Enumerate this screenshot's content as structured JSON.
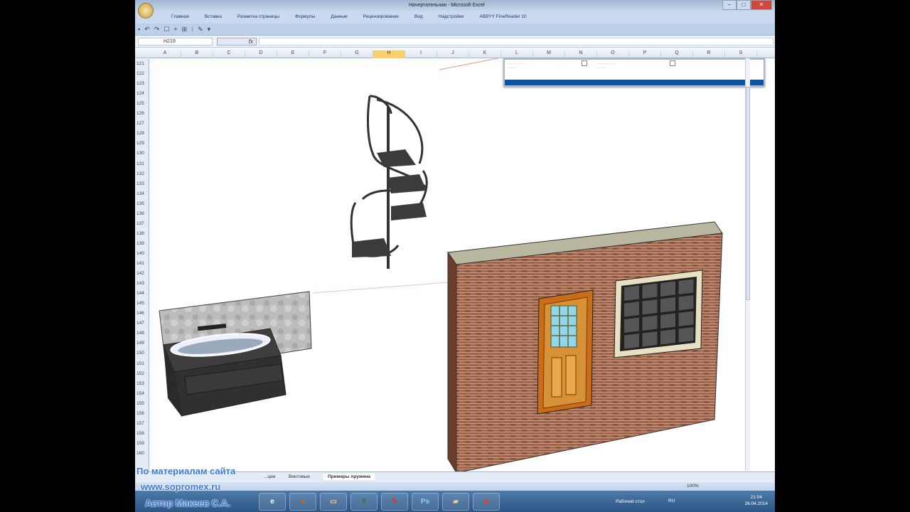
{
  "window": {
    "title": "Начертательная - Microsoft Excel"
  },
  "ribbon": {
    "tabs": [
      "Главная",
      "Вставка",
      "Разметка страницы",
      "Формулы",
      "Данные",
      "Рецензирование",
      "Вид",
      "Надстройки",
      "ABBYY FineReader 10"
    ]
  },
  "formula_bar": {
    "name_box": "H219",
    "fx": "fx",
    "value": ""
  },
  "columns": [
    "A",
    "B",
    "C",
    "D",
    "E",
    "F",
    "G",
    "H",
    "I",
    "J",
    "K",
    "L",
    "M",
    "N",
    "O",
    "P",
    "Q",
    "R",
    "S"
  ],
  "selected_column": "H",
  "rows": [
    121,
    122,
    123,
    124,
    125,
    126,
    127,
    128,
    129,
    130,
    131,
    132,
    133,
    134,
    135,
    136,
    137,
    138,
    139,
    140,
    141,
    142,
    143,
    144,
    145,
    146,
    147,
    148,
    149,
    150,
    151,
    152,
    153,
    154,
    155,
    156,
    157,
    158,
    159,
    160
  ],
  "sheet_tabs": [
    {
      "label": "...ции",
      "active": false
    },
    {
      "label": "Винтовые",
      "active": false
    },
    {
      "label": "Примеры пружина",
      "active": true
    }
  ],
  "status": {
    "zoom": "100%"
  },
  "taskbar": {
    "apps": [
      "ie",
      "firefox",
      "explorer",
      "excel",
      "pen-tool",
      "photoshop",
      "folder",
      "sketchup"
    ],
    "desktop_label": "Рабочий стол",
    "lang": "RU",
    "time": "21:04",
    "date": "26.04.2014"
  },
  "watermark": {
    "line1": "По материалам сайта",
    "line2": "www.sopromex.ru",
    "line3": "Автор Макеев С.А."
  },
  "colors": {
    "brick": "#9a5a3e",
    "ribbon": "#c9daf0",
    "taskbar": "#2b5686",
    "selected_header": "#f8cf6a"
  }
}
